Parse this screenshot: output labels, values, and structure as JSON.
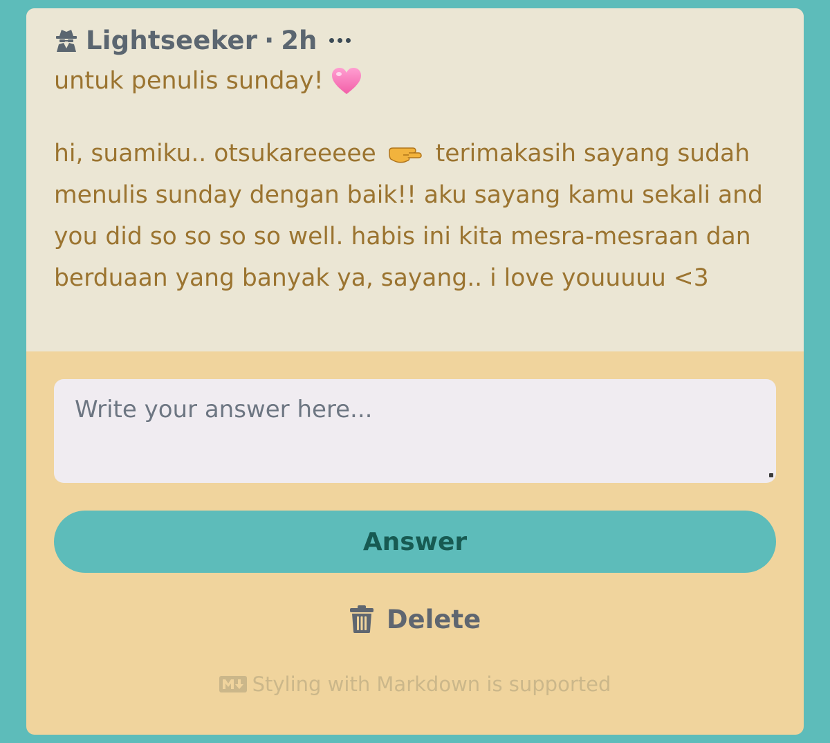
{
  "post": {
    "author": "Lightseeker",
    "separator": "·",
    "time": "2h",
    "subject": "untuk penulis sunday!",
    "body_part1": "hi, suamiku.. otsukareeeee",
    "body_part2": "terimakasih sayang sudah menulis sunday dengan baik!! aku sayang kamu sekali and you did so so so so well. habis ini kita mesra-mesraan dan berduaan yang banyak ya, sayang.. i love youuuuu <3"
  },
  "answer": {
    "placeholder": "Write your answer here...",
    "button_label": "Answer",
    "delete_label": "Delete",
    "markdown_note": "Styling with Markdown is supported"
  },
  "icons": {
    "author": "spy-icon",
    "more": "more-icon",
    "heart": "heart-icon",
    "pointer": "pointing-hand-icon",
    "delete": "trash-icon",
    "markdown": "markdown-icon"
  },
  "colors": {
    "background": "#5dbcba",
    "question_bg": "#ebe6d4",
    "answer_bg": "#f0d49d",
    "text": "#9b7430",
    "button": "#5dbcba",
    "button_text": "#175a52"
  }
}
